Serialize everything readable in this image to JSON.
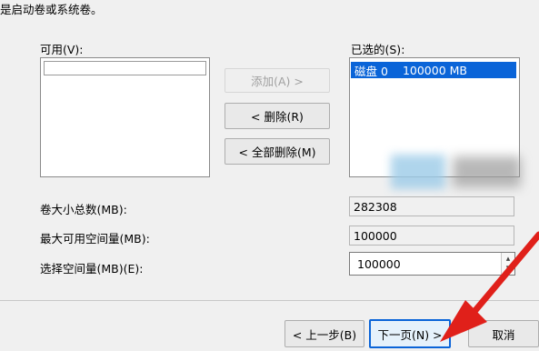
{
  "header": {
    "line1_cut": "",
    "line2": "是启动卷或系统卷。"
  },
  "available": {
    "label": "可用(V):"
  },
  "selected": {
    "label": "已选的(S):",
    "items": [
      {
        "disk": "磁盘 0",
        "size": "100000 MB"
      }
    ]
  },
  "buttons": {
    "add": "添加(A) >",
    "remove": "< 删除(R)",
    "remove_all": "< 全部删除(M)",
    "back": "< 上一步(B)",
    "next": "下一页(N) >",
    "cancel": "取消"
  },
  "fields": {
    "total_label": "卷大小总数(MB):",
    "total_value": "282308",
    "max_label": "最大可用空间量(MB):",
    "max_value": "100000",
    "select_label": "选择空间量(MB)(E):",
    "select_value": "100000"
  },
  "colors": {
    "selection": "#0a64d8",
    "annotation_arrow": "#e0201a"
  }
}
